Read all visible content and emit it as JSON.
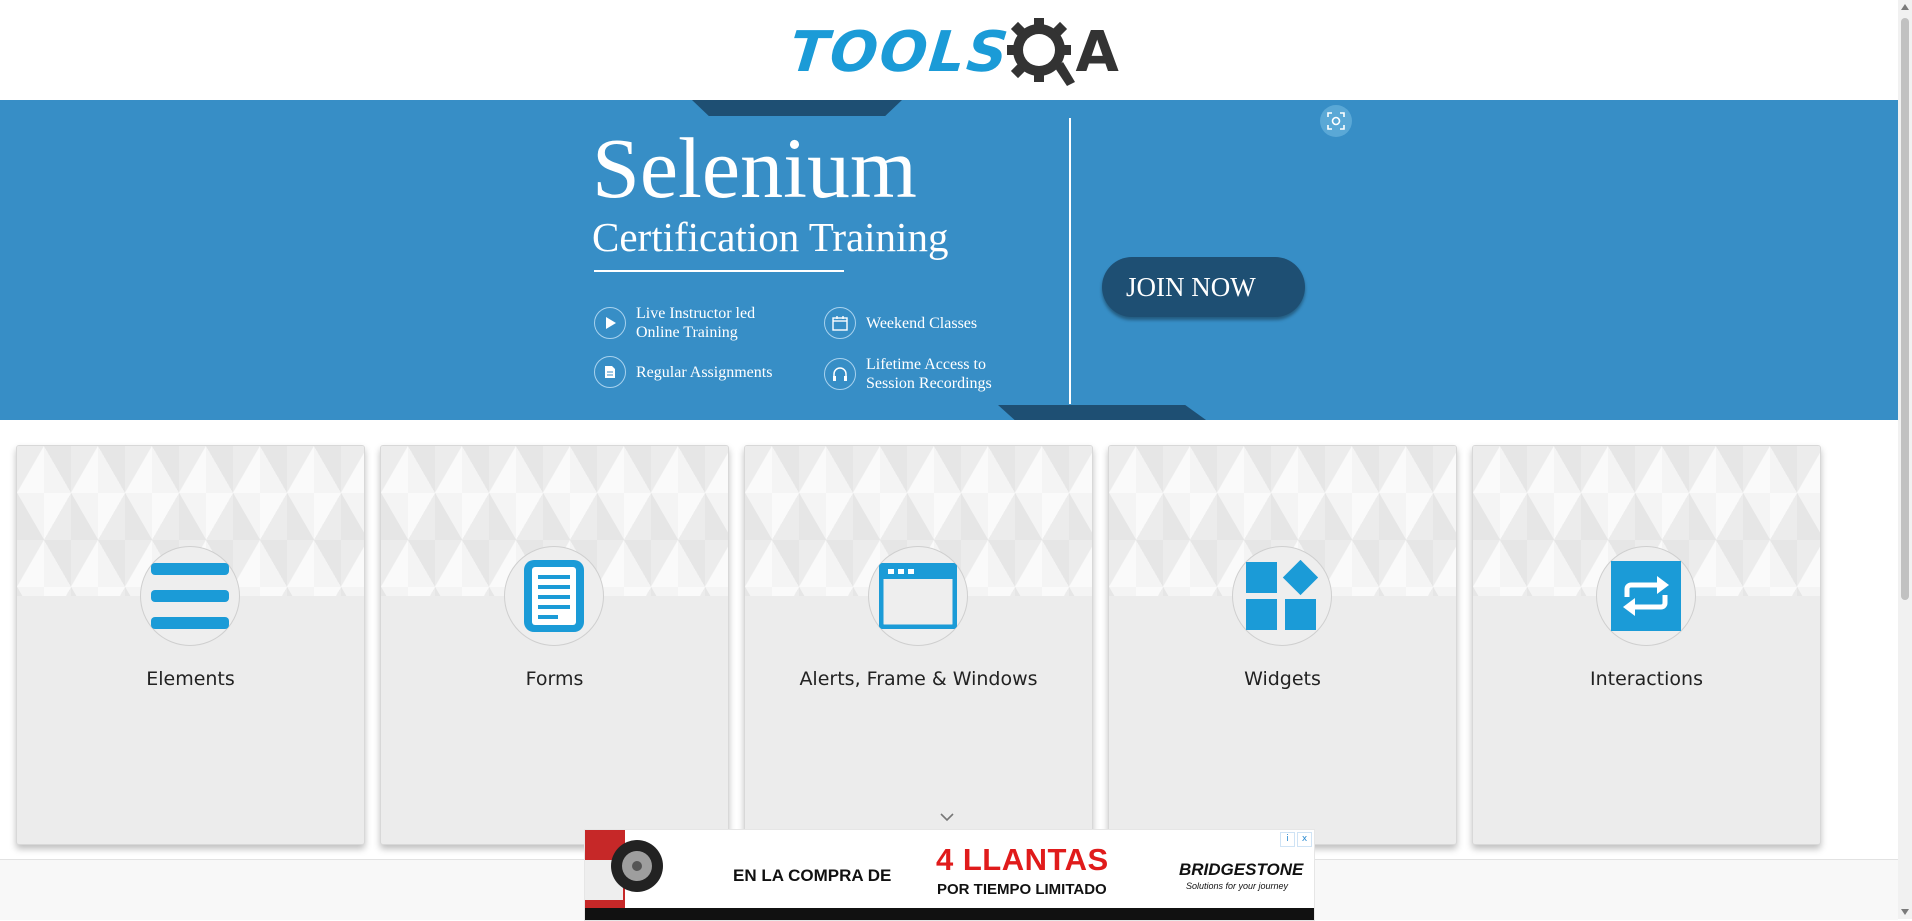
{
  "header": {
    "logo_text": "TOOLSQA",
    "logo_part1": "TOOLS",
    "logo_part2": "A"
  },
  "banner": {
    "title": "Selenium",
    "subtitle": "Certification Training",
    "features": [
      {
        "icon": "play-icon",
        "label": "Live Instructor led Online Training"
      },
      {
        "icon": "calendar-icon",
        "label": "Weekend Classes"
      },
      {
        "icon": "document-icon",
        "label": "Regular Assignments"
      },
      {
        "icon": "headphones-icon",
        "label": "Lifetime Access to Session Recordings"
      }
    ],
    "cta_label": "JOIN NOW",
    "colors": {
      "background": "#378ec6",
      "accent_dark": "#1e4f73"
    }
  },
  "cards": [
    {
      "title": "Elements",
      "icon": "hamburger-list-icon"
    },
    {
      "title": "Forms",
      "icon": "form-document-icon"
    },
    {
      "title": "Alerts, Frame & Windows",
      "icon": "browser-window-icon"
    },
    {
      "title": "Widgets",
      "icon": "widgets-grid-icon"
    },
    {
      "title": "Interactions",
      "icon": "arrows-exchange-icon"
    }
  ],
  "ad": {
    "lead_text": "EN LA COMPRA DE",
    "headline": "4 LLANTAS",
    "subline": "POR TIEMPO LIMITADO",
    "brand": "BRIDGESTONE",
    "tagline": "Solutions for your journey",
    "controls": [
      "i",
      "x"
    ]
  },
  "colors": {
    "icon_blue": "#1b9bd7",
    "card_bg": "#ececec"
  }
}
